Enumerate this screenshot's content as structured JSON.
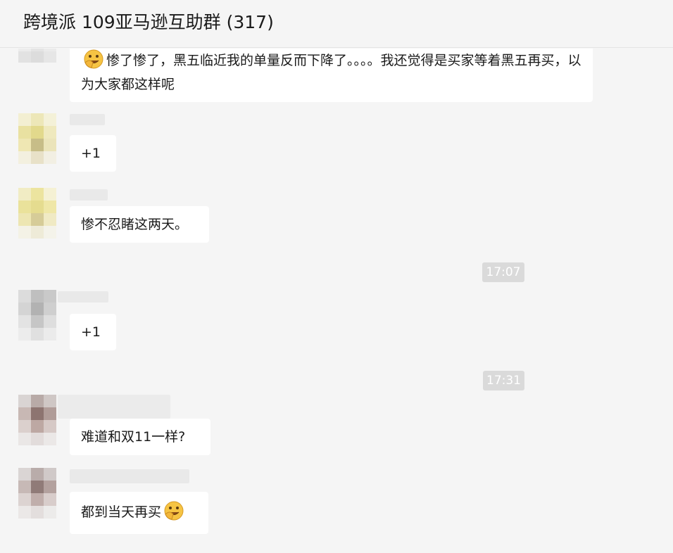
{
  "header": {
    "title": "跨境派 109亚马逊互助群 (317)"
  },
  "messages": [
    {
      "text_before_emoji": "",
      "text": "惨了惨了，黑五临近我的单量反而下降了。。。。我还觉得是买家等着黑五再买，以为大家都这样呢",
      "emoji": "facepalm-laugh-icon"
    },
    {
      "text": "+1"
    },
    {
      "text": "惨不忍睹这两天。"
    },
    {
      "time": "17:07"
    },
    {
      "text": "+1"
    },
    {
      "time": "17:31"
    },
    {
      "text": "难道和双11一样?"
    },
    {
      "text": "都到当天再买",
      "emoji": "facepalm-laugh-icon"
    }
  ]
}
